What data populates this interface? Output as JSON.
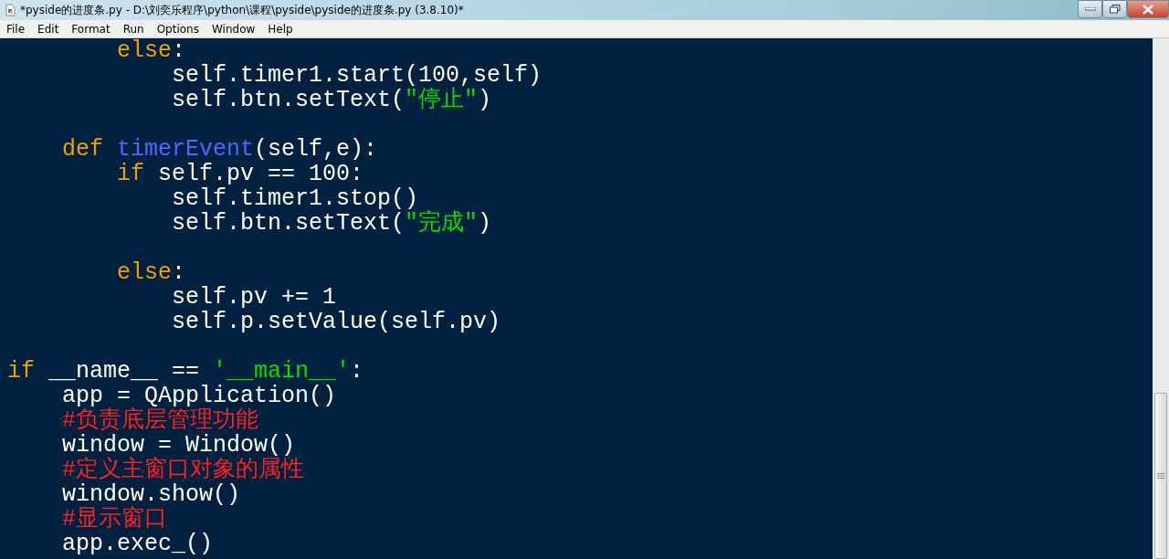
{
  "window": {
    "title": "*pyside的进度条.py - D:\\刘奕乐程序\\python\\课程\\pyside\\pyside的进度条.py (3.8.10)*"
  },
  "menu": [
    "File",
    "Edit",
    "Format",
    "Run",
    "Options",
    "Window",
    "Help"
  ],
  "code_lines": [
    {
      "kind": "code",
      "tokens": [
        {
          "kind": "keyword",
          "text": "        else"
        },
        {
          "kind": "plain",
          "text": ":"
        }
      ]
    },
    {
      "kind": "code",
      "tokens": [
        {
          "kind": "plain",
          "text": "            self.timer1.start(100,self)"
        }
      ]
    },
    {
      "kind": "code",
      "tokens": [
        {
          "kind": "plain",
          "text": "            self.btn.setText("
        },
        {
          "kind": "string",
          "text": "″停止″"
        },
        {
          "kind": "plain",
          "text": ")"
        }
      ]
    },
    {
      "kind": "blank"
    },
    {
      "kind": "code",
      "tokens": [
        {
          "kind": "keyword",
          "text": "    def "
        },
        {
          "kind": "definition",
          "text": "timerEvent"
        },
        {
          "kind": "plain",
          "text": "(self,e):"
        }
      ]
    },
    {
      "kind": "code",
      "tokens": [
        {
          "kind": "keyword",
          "text": "        if"
        },
        {
          "kind": "plain",
          "text": " self.pv == 100:"
        }
      ]
    },
    {
      "kind": "code",
      "tokens": [
        {
          "kind": "plain",
          "text": "            self.timer1.stop()"
        }
      ]
    },
    {
      "kind": "code",
      "tokens": [
        {
          "kind": "plain",
          "text": "            self.btn.setText("
        },
        {
          "kind": "string",
          "text": "″完成″"
        },
        {
          "kind": "plain",
          "text": ")"
        }
      ]
    },
    {
      "kind": "blank"
    },
    {
      "kind": "code",
      "tokens": [
        {
          "kind": "keyword",
          "text": "        else"
        },
        {
          "kind": "plain",
          "text": ":"
        }
      ]
    },
    {
      "kind": "code",
      "tokens": [
        {
          "kind": "plain",
          "text": "            self.pv += 1"
        }
      ]
    },
    {
      "kind": "code",
      "tokens": [
        {
          "kind": "plain",
          "text": "            self.p.setValue(self.pv)"
        }
      ]
    },
    {
      "kind": "blank"
    },
    {
      "kind": "code",
      "tokens": [
        {
          "kind": "keyword",
          "text": "if"
        },
        {
          "kind": "plain",
          "text": " __name__ == "
        },
        {
          "kind": "string",
          "text": "'__main__'"
        },
        {
          "kind": "plain",
          "text": ":"
        }
      ]
    },
    {
      "kind": "code",
      "tokens": [
        {
          "kind": "plain",
          "text": "    app = QApplication()"
        }
      ]
    },
    {
      "kind": "code",
      "tokens": [
        {
          "kind": "comment",
          "text": "    #负责底层管理功能"
        }
      ]
    },
    {
      "kind": "code",
      "tokens": [
        {
          "kind": "plain",
          "text": "    window = Window()"
        }
      ]
    },
    {
      "kind": "code",
      "tokens": [
        {
          "kind": "comment",
          "text": "    #定义主窗口对象的属性"
        }
      ]
    },
    {
      "kind": "code",
      "tokens": [
        {
          "kind": "plain",
          "text": "    window.show()"
        }
      ]
    },
    {
      "kind": "code",
      "tokens": [
        {
          "kind": "comment",
          "text": "    #显示窗口"
        }
      ]
    },
    {
      "kind": "code",
      "tokens": [
        {
          "kind": "plain",
          "text": "    app.exec_()"
        }
      ]
    }
  ]
}
